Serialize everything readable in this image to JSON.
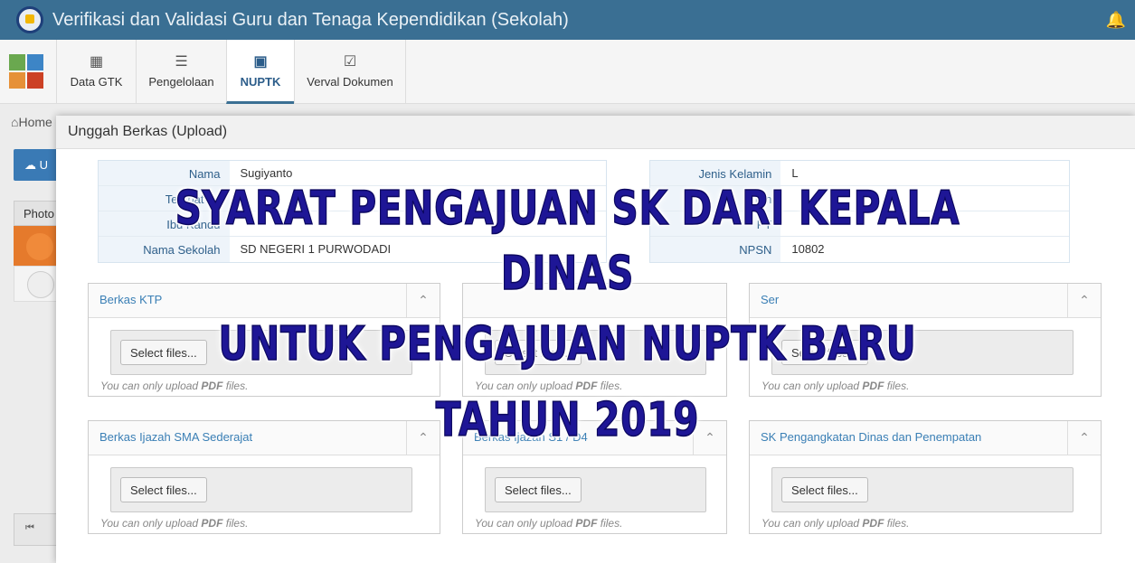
{
  "header": {
    "title": "Verifikasi dan Validasi Guru dan Tenaga Kependidikan (Sekolah)",
    "logo_icon": "tut-wuri-handayani-logo",
    "notification_icon": "bell-icon"
  },
  "nav": {
    "items": [
      {
        "label": "Data GTK",
        "icon": "table-icon"
      },
      {
        "label": "Pengelolaan",
        "icon": "list-icon"
      },
      {
        "label": "NUPTK",
        "icon": "id-card-icon"
      },
      {
        "label": "Verval Dokumen",
        "icon": "checkbox-icon"
      }
    ],
    "active": "NUPTK"
  },
  "background": {
    "breadcrumb": "Home",
    "button_label": "U",
    "table_header": "Photo"
  },
  "modal": {
    "title": "Unggah Berkas (Upload)",
    "info_left": [
      {
        "label": "Nama",
        "value": "Sugiyanto"
      },
      {
        "label": "Tempat La",
        "value": ""
      },
      {
        "label": "Ibu Kandu",
        "value": ""
      },
      {
        "label": "Nama Sekolah",
        "value": "SD NEGERI 1 PURWODADI"
      }
    ],
    "info_right": [
      {
        "label": "Jenis Kelamin",
        "value": "L"
      },
      {
        "label": "Tan",
        "value": ""
      },
      {
        "label": "PT",
        "value": ""
      },
      {
        "label": "NPSN",
        "value": "10802"
      }
    ],
    "panels": [
      {
        "title": "Berkas KTP",
        "button": "Select files...",
        "hint_prefix": "You can only upload ",
        "hint_bold": "PDF",
        "hint_suffix": " files."
      },
      {
        "title": "",
        "button": "Select files...",
        "hint_prefix": "You can only upload ",
        "hint_bold": "PDF",
        "hint_suffix": " files."
      },
      {
        "title": "Ser",
        "button": "Select files...",
        "hint_prefix": "You can only upload ",
        "hint_bold": "PDF",
        "hint_suffix": " files."
      },
      {
        "title": "Berkas Ijazah SMA Sederajat",
        "button": "Select files...",
        "hint_prefix": "You can only upload ",
        "hint_bold": "PDF",
        "hint_suffix": " files."
      },
      {
        "title": "Berkas Ijazah S1 / D4",
        "button": "Select files...",
        "hint_prefix": "You can only upload ",
        "hint_bold": "PDF",
        "hint_suffix": " files."
      },
      {
        "title": "SK Pengangkatan Dinas dan Penempatan",
        "button": "Select files...",
        "hint_prefix": "You can only upload ",
        "hint_bold": "PDF",
        "hint_suffix": " files."
      }
    ]
  },
  "overlay": {
    "line1": "SYARAT PENGAJUAN SK DARI KEPALA DINAS",
    "line2": "UNTUK PENGAJUAN NUPTK BARU",
    "line3": "TAHUN 2019",
    "color": "#1e1696"
  },
  "colors": {
    "header_bg": "#3a6f93",
    "accent": "#3a7fb5",
    "apps_grid": [
      "#6aa84f",
      "#3d85c6",
      "#e69138",
      "#cc4125"
    ]
  }
}
